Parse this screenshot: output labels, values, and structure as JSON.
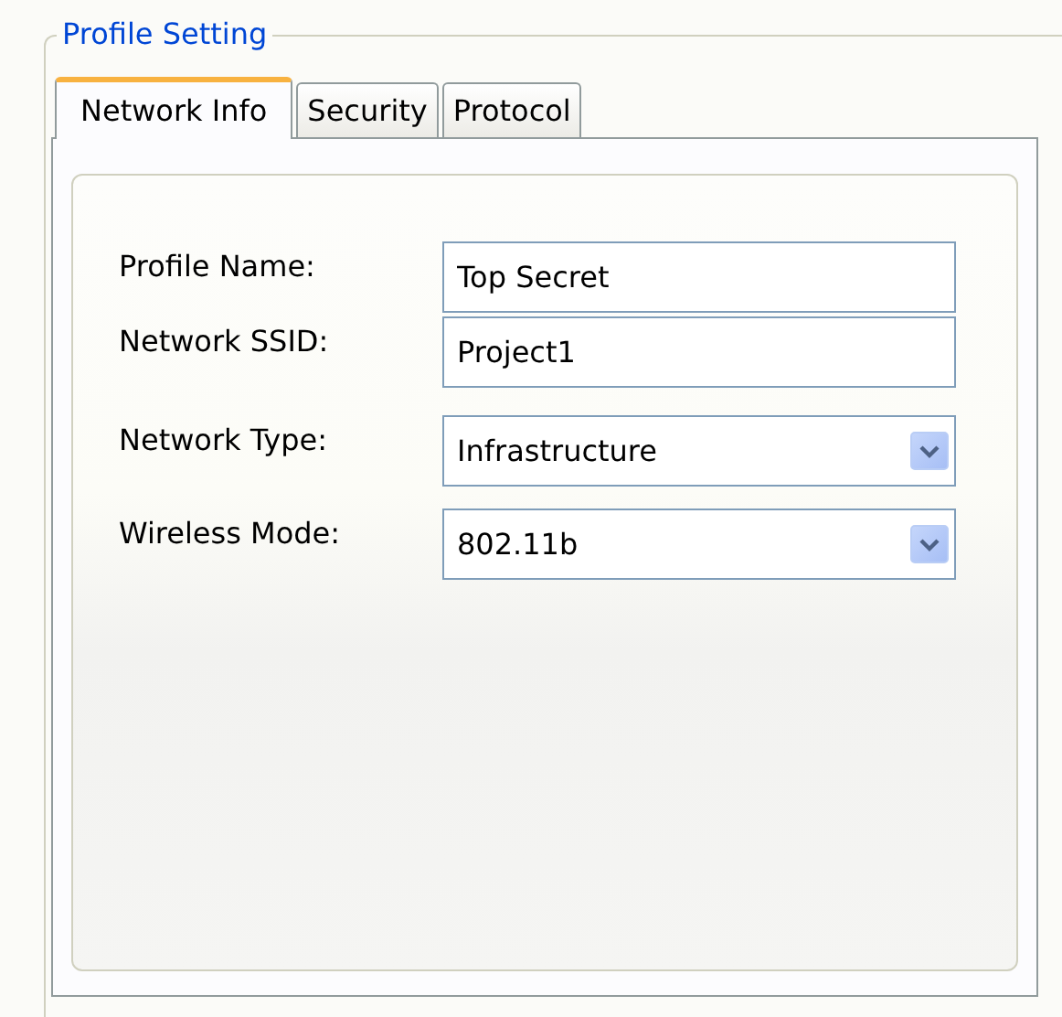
{
  "group": {
    "title": "Profile Setting"
  },
  "tabs": [
    {
      "label": "Network Info",
      "selected": true
    },
    {
      "label": "Security",
      "selected": false
    },
    {
      "label": "Protocol",
      "selected": false
    }
  ],
  "fields": [
    {
      "kind": "text",
      "label": "Profile Name:",
      "value": "Top Secret"
    },
    {
      "kind": "text",
      "label": "Network SSID:",
      "value": "Project1"
    },
    {
      "kind": "dropdown",
      "label": "Network Type:",
      "value": "Infrastructure"
    },
    {
      "kind": "dropdown",
      "label": "Wireless Mode:",
      "value": "802.11b"
    }
  ]
}
